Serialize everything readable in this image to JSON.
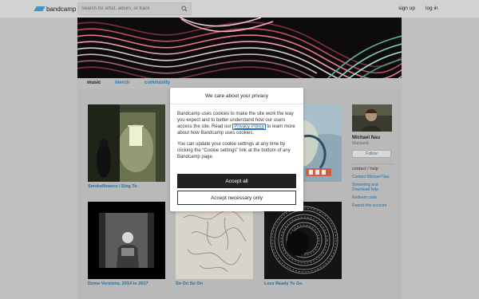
{
  "header": {
    "logo_text": "bandcamp",
    "search_placeholder": "Search for artist, album, or track",
    "signup": "sign up",
    "login": "log in"
  },
  "tabs": [
    {
      "label": "music"
    },
    {
      "label": "merch"
    },
    {
      "label": "community"
    }
  ],
  "albums": [
    {
      "title": "Smokeflowers / Sing To"
    },
    {
      "title": ""
    },
    {
      "title": ""
    },
    {
      "title": "Demo Versions, 2014 to 2017"
    },
    {
      "title": "So On So On"
    },
    {
      "title": "Less Ready To Go"
    }
  ],
  "sidebar": {
    "artist_name": "Michael Nau",
    "location": "Maryland",
    "follow_label": "Follow",
    "contact_heading": "contact / help",
    "links": [
      {
        "label": "Contact Michael Nau"
      },
      {
        "label": "Streaming and Download help"
      },
      {
        "label": "Redeem code"
      },
      {
        "label": "Report this account"
      }
    ]
  },
  "cookie_modal": {
    "title": "We care about your privacy",
    "p1_before": "Bandcamp uses cookies to make the site work the way you expect and to better understand how our users access the site. Read our ",
    "p1_link": "Privacy Policy",
    "p1_after": " to learn more about how Bandcamp uses cookies.",
    "p2": "You can update your cookie settings at any time by clicking the “Cookie settings” link at the bottom of any Bandcamp page.",
    "accept_all": "Accept all",
    "accept_necessary": "Accept necessary only"
  },
  "colors": {
    "link_blue": "#2a6c9a",
    "logo_blue": "#3a98c6",
    "button_dark": "#222222"
  },
  "icons": [
    "search-icon",
    "bandcamp-logo-icon"
  ]
}
